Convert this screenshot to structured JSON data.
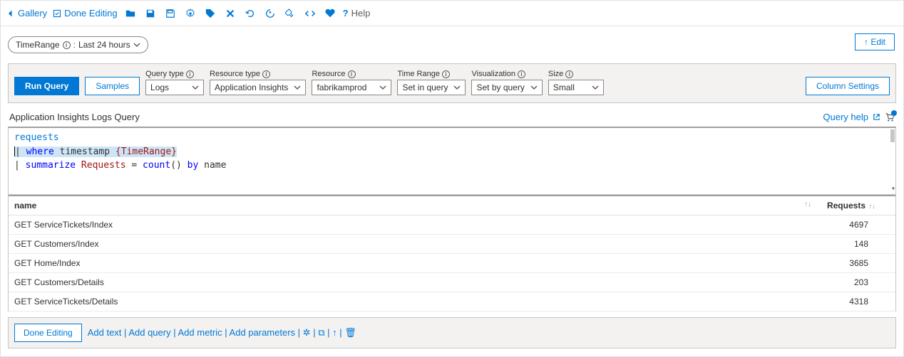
{
  "toolbar": {
    "gallery": "Gallery",
    "done_editing": "Done Editing",
    "help": "Help"
  },
  "time_range_pill": {
    "label": "TimeRange",
    "sep": ":",
    "value": "Last 24 hours"
  },
  "edit_button": "↑ Edit",
  "query_config": {
    "run": "Run Query",
    "samples": "Samples",
    "query_type": {
      "label": "Query type",
      "value": "Logs"
    },
    "resource_type": {
      "label": "Resource type",
      "value": "Application Insights"
    },
    "resource": {
      "label": "Resource",
      "value": "fabrikamprod"
    },
    "time_range": {
      "label": "Time Range",
      "value": "Set in query"
    },
    "visualization": {
      "label": "Visualization",
      "value": "Set by query"
    },
    "size": {
      "label": "Size",
      "value": "Small"
    },
    "column_settings": "Column Settings"
  },
  "editor": {
    "title": "Application Insights Logs Query",
    "query_help": "Query help",
    "line1_table": "requests",
    "line2_pipe": "| ",
    "line2_where": "where",
    "line2_field": " timestamp ",
    "line2_param": "{TimeRange}",
    "line3_pipe": "| ",
    "line3_summarize": "summarize",
    "line3_requests": " Requests",
    "line3_eq": " = ",
    "line3_count": "count",
    "line3_paren": "() ",
    "line3_by": "by",
    "line3_name": " name"
  },
  "results": {
    "columns": {
      "name": "name",
      "requests": "Requests"
    },
    "rows": [
      {
        "name": "GET ServiceTickets/Index",
        "requests": "4697"
      },
      {
        "name": "GET Customers/Index",
        "requests": "148"
      },
      {
        "name": "GET Home/Index",
        "requests": "3685"
      },
      {
        "name": "GET Customers/Details",
        "requests": "203"
      },
      {
        "name": "GET ServiceTickets/Details",
        "requests": "4318"
      }
    ]
  },
  "bottom": {
    "done_editing": "Done Editing",
    "add_text": "Add text",
    "add_query": "Add query",
    "add_metric": "Add metric",
    "add_parameters": "Add parameters"
  }
}
